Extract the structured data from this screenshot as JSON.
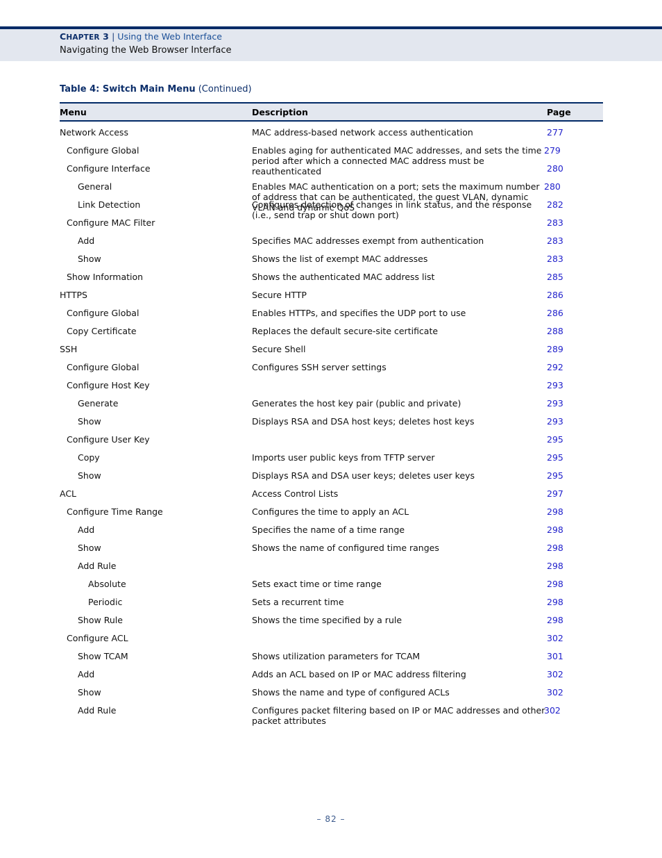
{
  "header": {
    "chapter_label": "Chapter 3",
    "chapter_label_first": "C",
    "chapter_label_rest": "HAPTER",
    "chapter_number": "3",
    "separator": "|",
    "chapter_name": "Using the Web Interface",
    "section_name": "Navigating the Web Browser Interface"
  },
  "table": {
    "caption_bold": "Table 4: Switch Main Menu",
    "caption_continued": "(Continued)",
    "columns": {
      "menu": "Menu",
      "description": "Description",
      "page": "Page"
    },
    "rows": [
      {
        "level": 0,
        "menu": "Network Access",
        "description": "MAC address-based network access authentication",
        "page": "277",
        "tight": false
      },
      {
        "level": 1,
        "menu": "Configure Global",
        "description": "Enables aging for authenticated MAC addresses, and sets the time period after which a connected MAC address must be reauthenticated",
        "page": "279",
        "tight": true
      },
      {
        "level": 1,
        "menu": "Configure Interface",
        "description": "",
        "page": "280",
        "tight": false
      },
      {
        "level": 2,
        "menu": "General",
        "description": "Enables MAC authentication on a port; sets the maximum number of address that can be authenticated, the guest VLAN, dynamic VLAN and dynamic QoS",
        "page": "280",
        "tight": true
      },
      {
        "level": 2,
        "menu": "Link Detection",
        "description": "Configures detection of changes in link status, and the response (i.e., send trap or shut down port)",
        "page": "282",
        "tight": false
      },
      {
        "level": 1,
        "menu": "Configure MAC Filter",
        "description": "",
        "page": "283",
        "tight": false
      },
      {
        "level": 2,
        "menu": "Add",
        "description": "Specifies MAC addresses exempt from authentication",
        "page": "283",
        "tight": false
      },
      {
        "level": 2,
        "menu": "Show",
        "description": "Shows the list of exempt MAC addresses",
        "page": "283",
        "tight": false
      },
      {
        "level": 1,
        "menu": "Show Information",
        "description": "Shows the authenticated MAC address list",
        "page": "285",
        "tight": false
      },
      {
        "level": 0,
        "menu": "HTTPS",
        "description": "Secure HTTP",
        "page": "286",
        "tight": false
      },
      {
        "level": 1,
        "menu": "Configure Global",
        "description": "Enables HTTPs, and specifies the UDP port to use",
        "page": "286",
        "tight": false
      },
      {
        "level": 1,
        "menu": "Copy Certificate",
        "description": "Replaces the default secure-site certificate",
        "page": "288",
        "tight": false
      },
      {
        "level": 0,
        "menu": "SSH",
        "description": "Secure Shell",
        "page": "289",
        "tight": false
      },
      {
        "level": 1,
        "menu": "Configure Global",
        "description": "Configures SSH server settings",
        "page": "292",
        "tight": false
      },
      {
        "level": 1,
        "menu": "Configure Host Key",
        "description": "",
        "page": "293",
        "tight": false
      },
      {
        "level": 2,
        "menu": "Generate",
        "description": "Generates the host key pair (public and private)",
        "page": "293",
        "tight": false
      },
      {
        "level": 2,
        "menu": "Show",
        "description": "Displays RSA and DSA host keys; deletes host keys",
        "page": "293",
        "tight": false
      },
      {
        "level": 1,
        "menu": "Configure User Key",
        "description": "",
        "page": "295",
        "tight": false
      },
      {
        "level": 2,
        "menu": "Copy",
        "description": "Imports user public keys from TFTP server",
        "page": "295",
        "tight": false
      },
      {
        "level": 2,
        "menu": "Show",
        "description": "Displays RSA and DSA user keys; deletes user keys",
        "page": "295",
        "tight": false
      },
      {
        "level": 0,
        "menu": "ACL",
        "description": "Access Control Lists",
        "page": "297",
        "tight": false
      },
      {
        "level": 1,
        "menu": "Configure Time Range",
        "description": "Configures the time to apply an ACL",
        "page": "298",
        "tight": false
      },
      {
        "level": 2,
        "menu": "Add",
        "description": "Specifies the name of a time range",
        "page": "298",
        "tight": false
      },
      {
        "level": 2,
        "menu": "Show",
        "description": "Shows the name of configured time ranges",
        "page": "298",
        "tight": false
      },
      {
        "level": 2,
        "menu": "Add Rule",
        "description": "",
        "page": "298",
        "tight": false
      },
      {
        "level": 3,
        "menu": "Absolute",
        "description": "Sets exact time or time range",
        "page": "298",
        "tight": false
      },
      {
        "level": 3,
        "menu": "Periodic",
        "description": "Sets a recurrent time",
        "page": "298",
        "tight": false
      },
      {
        "level": 2,
        "menu": "Show Rule",
        "description": "Shows the time specified by a rule",
        "page": "298",
        "tight": false
      },
      {
        "level": 1,
        "menu": "Configure ACL",
        "description": "",
        "page": "302",
        "tight": false
      },
      {
        "level": 2,
        "menu": "Show TCAM",
        "description": "Shows utilization parameters for TCAM",
        "page": "301",
        "tight": false
      },
      {
        "level": 2,
        "menu": "Add",
        "description": "Adds an ACL based on IP or MAC address filtering",
        "page": "302",
        "tight": false
      },
      {
        "level": 2,
        "menu": "Show",
        "description": "Shows the name and type of configured ACLs",
        "page": "302",
        "tight": false
      },
      {
        "level": 2,
        "menu": "Add Rule",
        "description": "Configures packet filtering based on IP or MAC addresses and other packet attributes",
        "page": "302",
        "tight": true
      }
    ]
  },
  "footer": {
    "page_marker": "–  82  –"
  },
  "colors": {
    "navy_rule": "#022a67",
    "header_band": "#e3e7ef",
    "link_blue": "#2222cc",
    "caption_navy": "#0d2f6b",
    "footer_blue": "#3c5a8c"
  }
}
